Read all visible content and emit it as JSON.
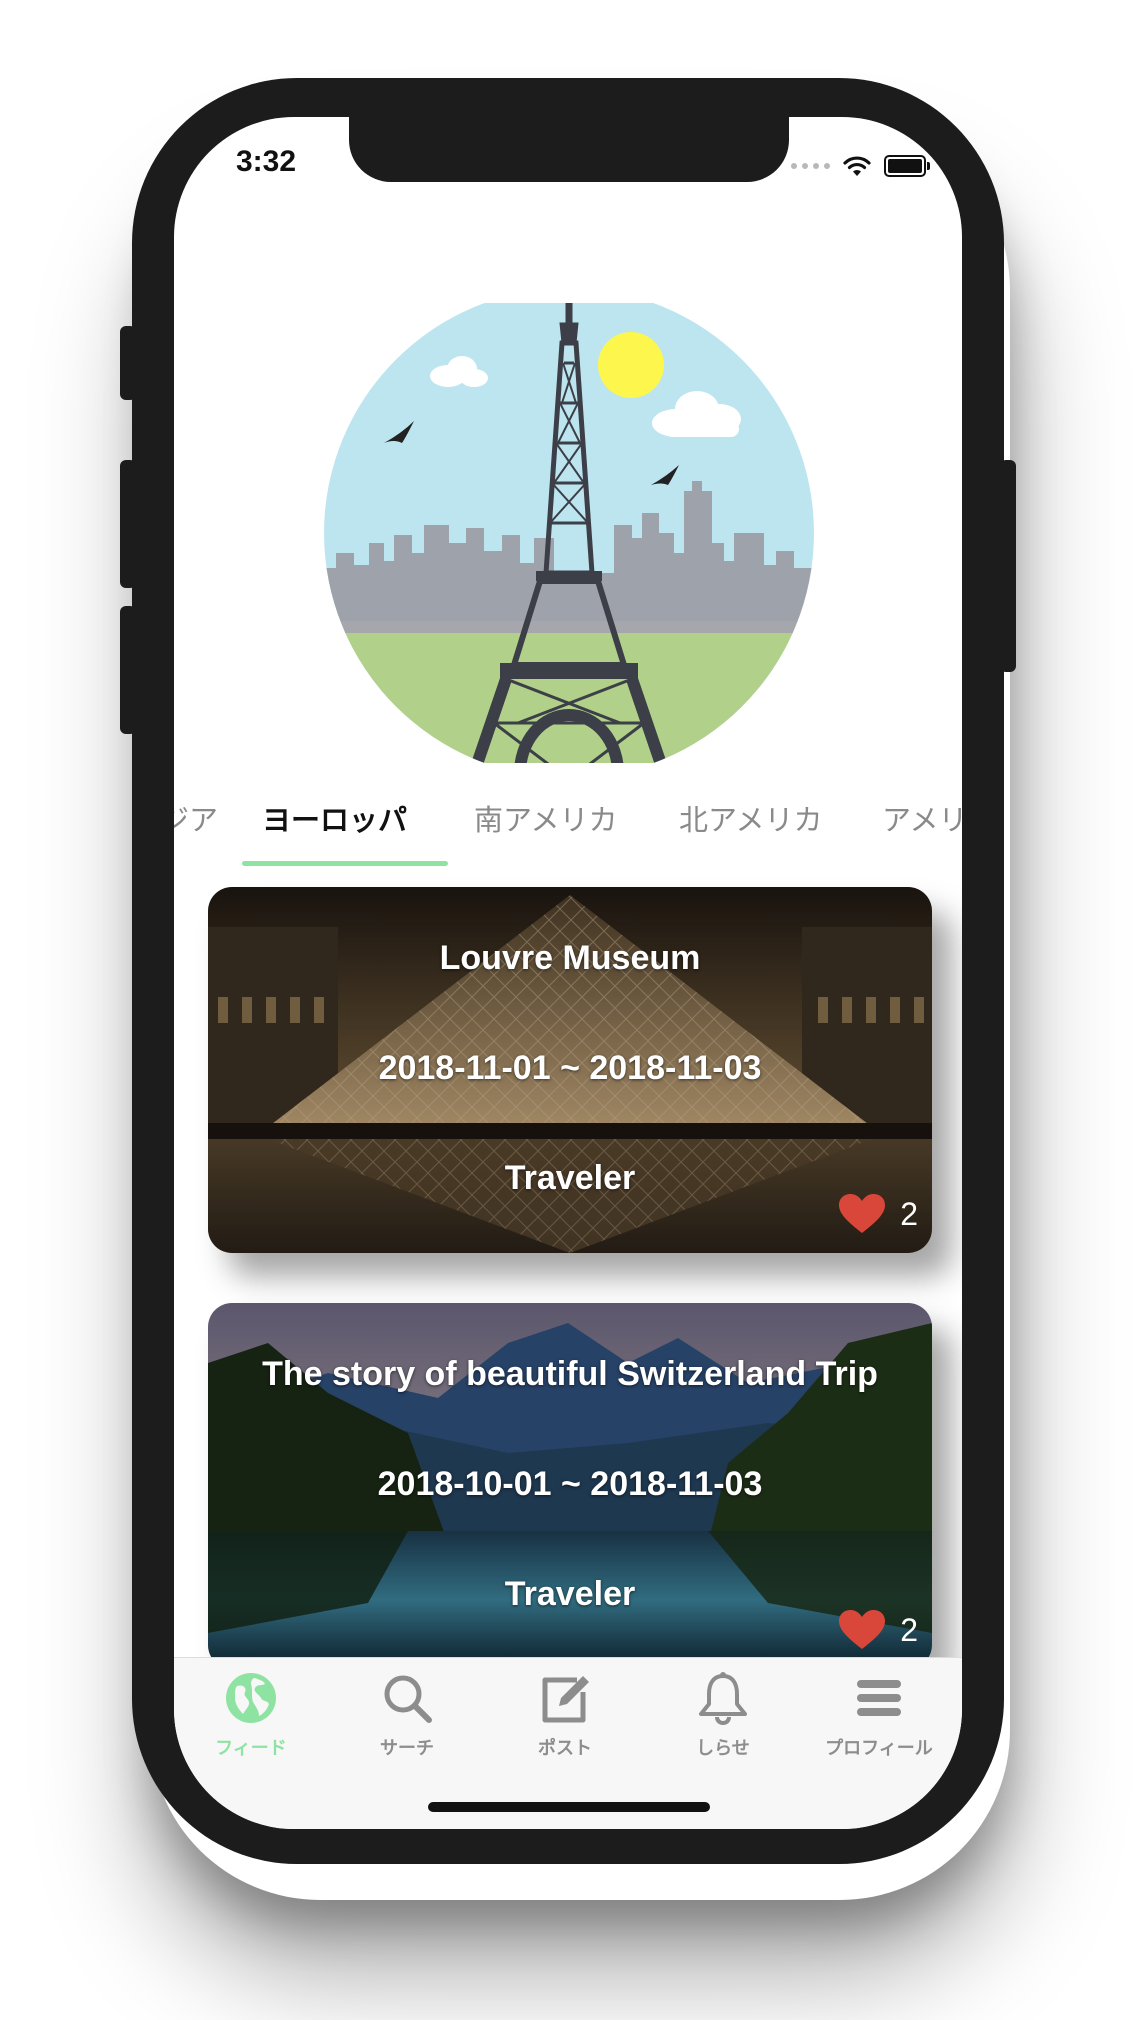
{
  "status_bar": {
    "time": "3:32"
  },
  "hero": {
    "icon": "eiffel-tower-illustration"
  },
  "region_tabs": [
    {
      "label": "ジア"
    },
    {
      "label": "ヨーロッパ",
      "active": true
    },
    {
      "label": "南アメリカ"
    },
    {
      "label": "北アメリカ"
    },
    {
      "label": "アメリ"
    }
  ],
  "posts": [
    {
      "title": "Louvre Museum",
      "dates": "2018-11-01 ~ 2018-11-03",
      "author": "Traveler",
      "likes": "2",
      "image": "louvre-pyramid-night"
    },
    {
      "title": "The story of beautiful Switzerland Trip",
      "dates": "2018-10-01 ~ 2018-11-03",
      "author": "Traveler",
      "likes": "2",
      "image": "swiss-lake-mountains"
    }
  ],
  "tabbar": {
    "items": [
      {
        "label": "フィード",
        "icon": "globe-icon",
        "active": true
      },
      {
        "label": "サーチ",
        "icon": "search-icon"
      },
      {
        "label": "ポスト",
        "icon": "edit-icon"
      },
      {
        "label": "しらせ",
        "icon": "bell-icon"
      },
      {
        "label": "プロフィール",
        "icon": "menu-icon"
      }
    ]
  },
  "colors": {
    "accent": "#8fe3a2",
    "heart": "#d9473a",
    "tab_inactive": "#8a8a8a"
  }
}
